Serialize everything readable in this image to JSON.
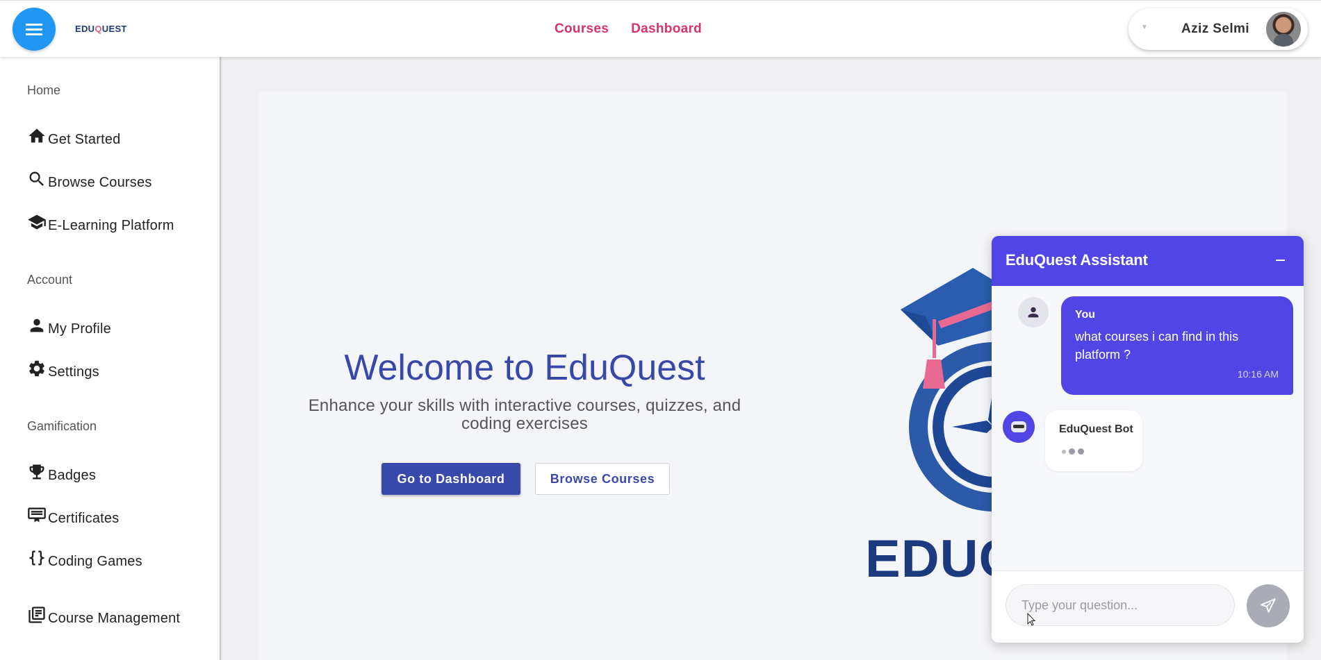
{
  "header": {
    "logo": {
      "pre": "EDU",
      "u": "Q",
      "post": "UEST"
    },
    "nav": [
      {
        "label": "Courses"
      },
      {
        "label": "Dashboard"
      }
    ],
    "user": {
      "name": "Aziz Selmi"
    }
  },
  "sidebar": {
    "sections": [
      {
        "title": "Home",
        "items": [
          {
            "label": "Get Started",
            "icon": "home-icon"
          },
          {
            "label": "Browse Courses",
            "icon": "search-icon"
          },
          {
            "label": "E-Learning Platform",
            "icon": "school-icon"
          }
        ]
      },
      {
        "title": "Account",
        "items": [
          {
            "label": "My Profile",
            "icon": "person-icon"
          },
          {
            "label": "Settings",
            "icon": "gear-icon"
          }
        ]
      },
      {
        "title": "Gamification",
        "items": [
          {
            "label": "Badges",
            "icon": "trophy-icon"
          },
          {
            "label": "Certificates",
            "icon": "certificate-icon"
          },
          {
            "label": "Coding Games",
            "icon": "code-braces-icon"
          },
          {
            "label": "Course Management",
            "icon": "library-books-icon"
          }
        ]
      }
    ]
  },
  "hero": {
    "title": "Welcome to EduQuest",
    "subtitle": "Enhance your skills with interactive courses, quizzes, and coding exercises",
    "primary_button": "Go to Dashboard",
    "secondary_button": "Browse Courses",
    "logo_word": "EDUC"
  },
  "chat": {
    "title": "EduQuest Assistant",
    "messages": [
      {
        "sender": "You",
        "text": "what courses i can find in this platform ?",
        "time": "10:16 AM"
      },
      {
        "sender": "EduQuest Bot",
        "typing": true
      }
    ],
    "input_placeholder": "Type your question..."
  },
  "colors": {
    "primary": "#3949ab",
    "chat_accent": "#5046e5",
    "nav_link": "#d6336c",
    "menu_button": "#2196f3"
  }
}
